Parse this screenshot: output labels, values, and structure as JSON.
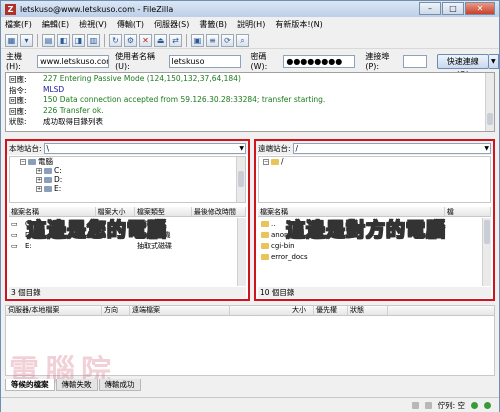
{
  "window": {
    "title": "letskuso@www.letskuso.com - FileZilla",
    "app_icon": "Z"
  },
  "menu": [
    "檔案(F)",
    "編輯(E)",
    "檢視(V)",
    "傳輸(T)",
    "伺服器(S)",
    "書籤(B)",
    "說明(H)",
    "有新版本!(N)"
  ],
  "quickconnect": {
    "host_label": "主機(H):",
    "host_value": "www.letskuso.com",
    "user_label": "使用者名稱(U):",
    "user_value": "letskuso",
    "pass_label": "密碼(W):",
    "pass_value": "●●●●●●●●",
    "port_label": "連接埠(P):",
    "port_value": "",
    "connect_label": "快速連線(Q)"
  },
  "log": [
    {
      "kind": "回應:",
      "msg": "227 Entering Passive Mode (124,150,132,37,64,184)",
      "color": "#1a7a1a"
    },
    {
      "kind": "指令:",
      "msg": "MLSD",
      "color": "#1a1aa8"
    },
    {
      "kind": "回應:",
      "msg": "150 Data connection accepted from 59.126.30.28:33284; transfer starting.",
      "color": "#1a7a1a"
    },
    {
      "kind": "回應:",
      "msg": "226 Transfer ok.",
      "color": "#1a7a1a"
    },
    {
      "kind": "狀態:",
      "msg": "成功取得目錄列表",
      "color": "#000000"
    }
  ],
  "local": {
    "site_label": "本地站台:",
    "path": "\\",
    "tree": [
      {
        "label": "電腦",
        "exp": "−",
        "indent": 10
      },
      {
        "label": "C:",
        "exp": "+",
        "indent": 26
      },
      {
        "label": "D:",
        "exp": "+",
        "indent": 26
      },
      {
        "label": "E:",
        "exp": "+",
        "indent": 26
      }
    ],
    "columns": [
      "檔案名稱",
      "檔案大小",
      "檔案類型",
      "最後修改時間"
    ],
    "files": [
      {
        "name": "C:",
        "size": "",
        "type": "本機磁碟"
      },
      {
        "name": "D:",
        "size": "",
        "type": "CD 光碟機"
      },
      {
        "name": "E:",
        "size": "",
        "type": "抽取式磁碟"
      }
    ],
    "status": "3 個目錄",
    "overlay": "這邊是您的電腦"
  },
  "remote": {
    "site_label": "遠端站台:",
    "path": "/",
    "tree": [
      {
        "label": "/",
        "exp": "−",
        "indent": 4
      }
    ],
    "columns": [
      "檔案名稱",
      "檔"
    ],
    "files": [
      {
        "name": ".."
      },
      {
        "name": "anon_ftp"
      },
      {
        "name": "cgi-bin"
      },
      {
        "name": "error_docs"
      }
    ],
    "status": "10 個目錄",
    "overlay": "這邊是對方的電腦"
  },
  "queue": {
    "columns": [
      "伺服器/本地檔案",
      "方向",
      "遠端檔案",
      "大小",
      "優先權",
      "狀態"
    ],
    "tabs": [
      "等候的檔案",
      "傳輸失敗",
      "傳輸成功"
    ],
    "status": "佇列: 空"
  },
  "watermark": "電腦院"
}
